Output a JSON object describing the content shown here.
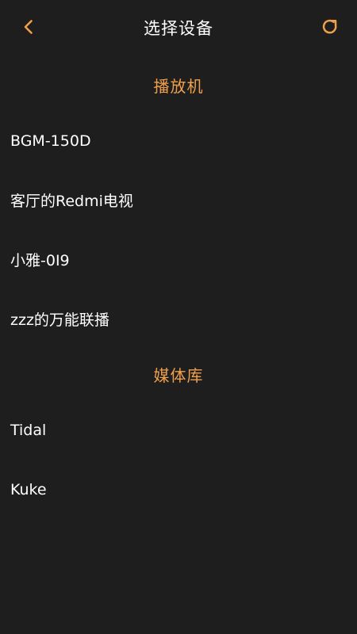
{
  "colors": {
    "background": "#1e1e1e",
    "accent": "#f0a04b",
    "text": "#ffffff"
  },
  "header": {
    "title": "选择设备",
    "back_icon": "chevron-left-icon",
    "refresh_icon": "refresh-icon"
  },
  "sections": {
    "players": {
      "title": "播放机",
      "items": [
        "BGM-150D",
        "客厅的Redmi电视",
        "小雅-0I9",
        "zzz的万能联播"
      ]
    },
    "media_library": {
      "title": "媒体库",
      "items": [
        "Tidal",
        "Kuke"
      ]
    }
  }
}
